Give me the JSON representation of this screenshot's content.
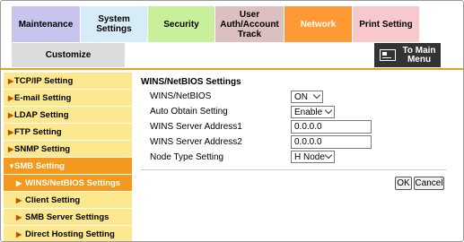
{
  "tabs": {
    "maintenance": "Maintenance",
    "system_settings": "System Settings",
    "security": "Security",
    "auth_line1": "User",
    "auth_line2": "Auth/Account",
    "auth_line3": "Track",
    "network": "Network",
    "print_setting": "Print Setting",
    "customize": "Customize"
  },
  "to_main": {
    "line1": "To Main",
    "line2": "Menu",
    "icon": "main-menu-icon"
  },
  "sidebar": {
    "items": [
      {
        "label": "TCP/IP Setting"
      },
      {
        "label": "E-mail Setting"
      },
      {
        "label": "LDAP Setting"
      },
      {
        "label": "FTP Setting"
      },
      {
        "label": "SNMP Setting"
      },
      {
        "label": "SMB Setting"
      },
      {
        "label": "WINS/NetBIOS Settings"
      },
      {
        "label": "Client Setting"
      },
      {
        "label": "SMB Server Settings"
      },
      {
        "label": "Direct Hosting Setting"
      }
    ]
  },
  "main": {
    "title": "WINS/NetBIOS Settings",
    "fields": {
      "wins_netbios": {
        "label": "WINS/NetBIOS",
        "value": "ON"
      },
      "auto_obtain": {
        "label": "Auto Obtain Setting",
        "value": "Enable"
      },
      "wins_server1": {
        "label": "WINS Server Address1",
        "value": "0.0.0.0"
      },
      "wins_server2": {
        "label": "WINS Server Address2",
        "value": "0.0.0.0"
      },
      "node_type": {
        "label": "Node Type Setting",
        "value": "H Node"
      }
    },
    "ok_label": "OK",
    "cancel_label": "Cancel"
  },
  "colors": {
    "accent": "#f39a1e",
    "network_tab": "#ff9933",
    "sidebar_bg": "#fce88e"
  }
}
